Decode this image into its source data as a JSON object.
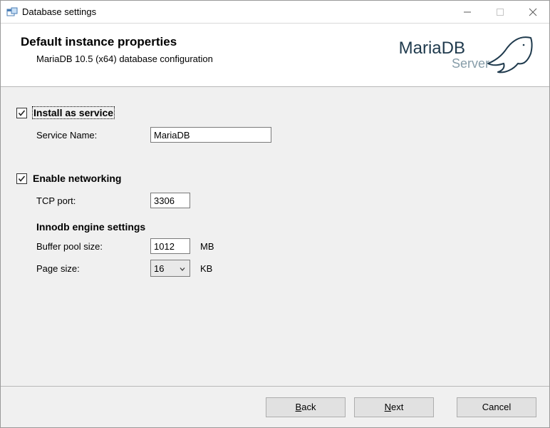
{
  "window": {
    "title": "Database settings"
  },
  "header": {
    "title": "Default instance properties",
    "subtitle": "MariaDB 10.5 (x64) database configuration",
    "logo_top": "MariaDB",
    "logo_bottom": "Server"
  },
  "form": {
    "install_service_label": "Install as service",
    "install_service_checked": true,
    "service_name_label": "Service Name:",
    "service_name_value": "MariaDB",
    "enable_networking_label": "Enable networking",
    "enable_networking_checked": true,
    "tcp_port_label": "TCP port:",
    "tcp_port_value": "3306",
    "innodb_title": "Innodb engine settings",
    "buffer_pool_label": "Buffer pool size:",
    "buffer_pool_value": "1012",
    "buffer_pool_unit": "MB",
    "page_size_label": "Page size:",
    "page_size_value": "16",
    "page_size_unit": "KB"
  },
  "buttons": {
    "back": "ack",
    "back_mn": "B",
    "next": "ext",
    "next_mn": "N",
    "cancel": "Cancel"
  }
}
